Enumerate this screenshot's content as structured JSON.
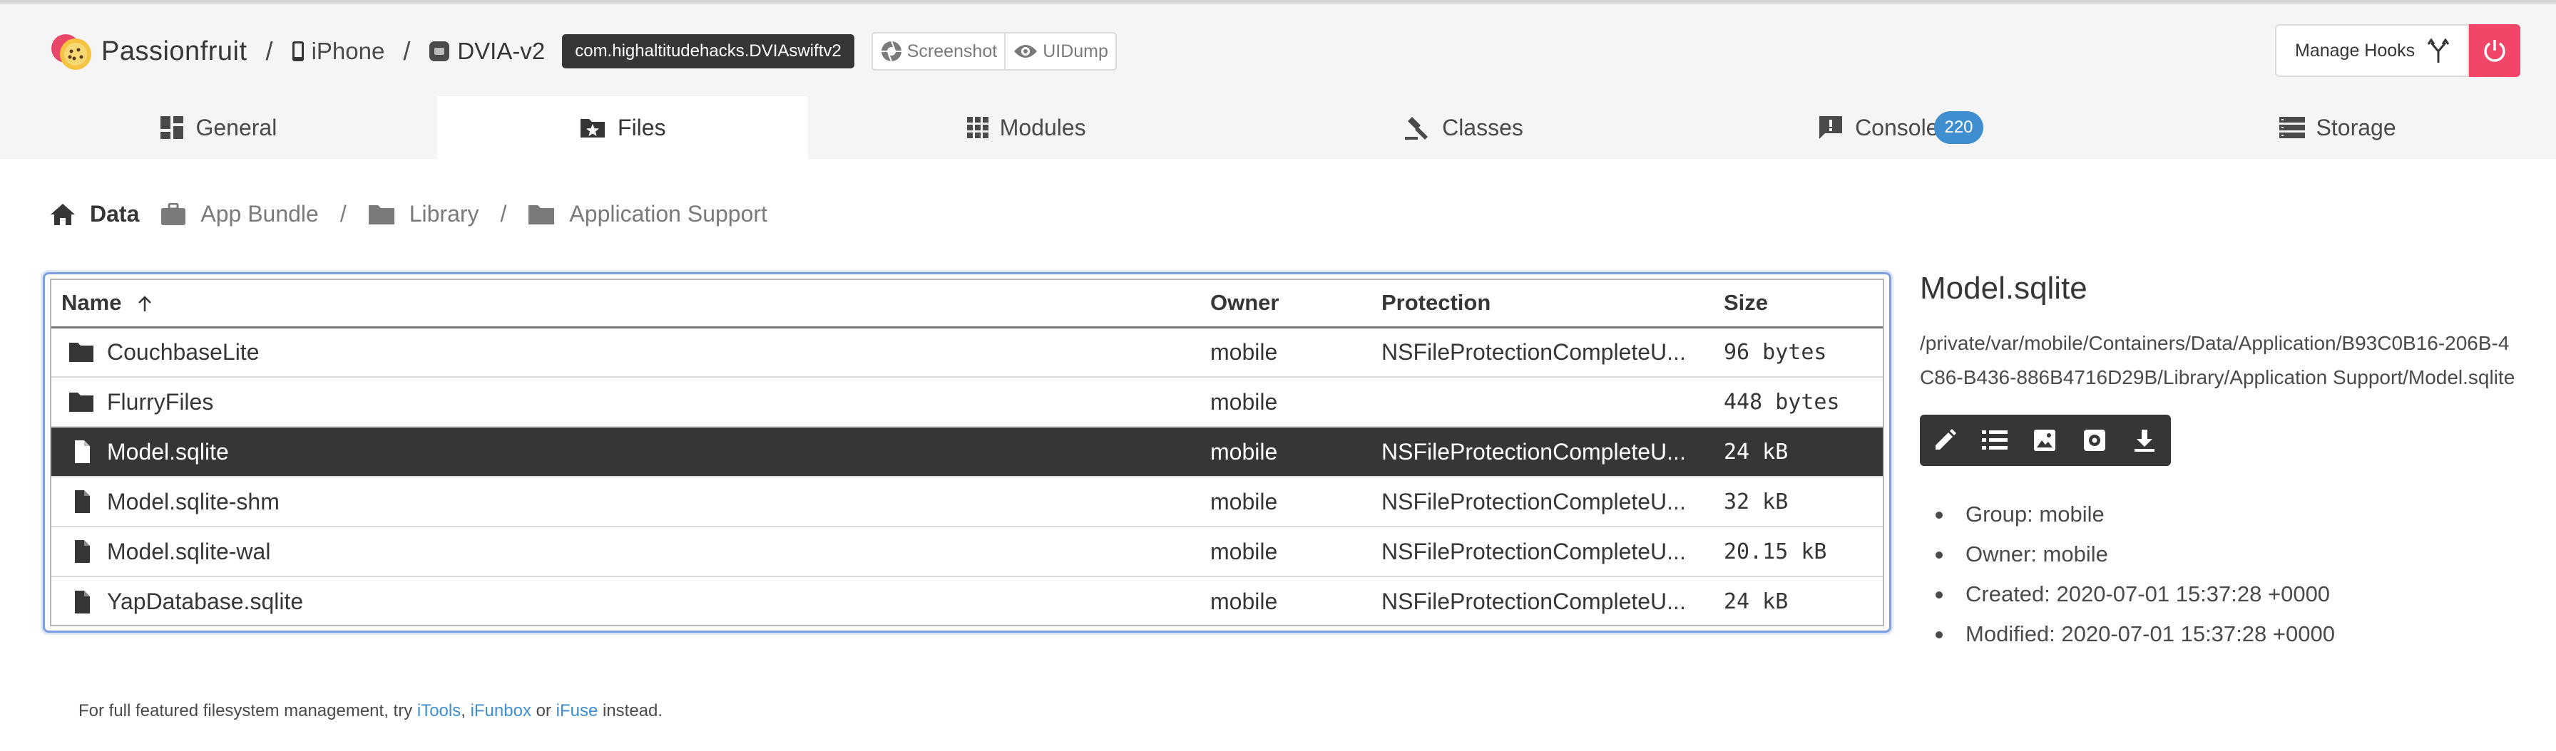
{
  "app": {
    "name": "Passionfruit"
  },
  "top_breadcrumb": {
    "device": "iPhone",
    "app": "DVIA-v2",
    "bundle_id": "com.highaltitudehacks.DVIAswiftv2"
  },
  "toolbar": {
    "screenshot_label": "Screenshot",
    "uidump_label": "UIDump",
    "manage_hooks_label": "Manage Hooks"
  },
  "tabs": [
    {
      "label": "General",
      "icon": "dashboard-icon"
    },
    {
      "label": "Files",
      "icon": "folder-star-icon",
      "active": true
    },
    {
      "label": "Modules",
      "icon": "grid-icon"
    },
    {
      "label": "Classes",
      "icon": "gavel-icon"
    },
    {
      "label": "Console",
      "icon": "alert-box-icon",
      "badge": "220"
    },
    {
      "label": "Storage",
      "icon": "storage-list-icon"
    }
  ],
  "breadcrumb": [
    "Data",
    "App Bundle",
    "Library",
    "Application Support"
  ],
  "table": {
    "headers": {
      "name": "Name",
      "owner": "Owner",
      "protection": "Protection",
      "size": "Size"
    },
    "sort": "ascending",
    "rows": [
      {
        "type": "folder",
        "name": "CouchbaseLite",
        "owner": "mobile",
        "protection": "NSFileProtectionCompleteU...",
        "size": "96 bytes"
      },
      {
        "type": "folder",
        "name": "FlurryFiles",
        "owner": "mobile",
        "protection": "",
        "size": "448 bytes"
      },
      {
        "type": "file",
        "name": "Model.sqlite",
        "owner": "mobile",
        "protection": "NSFileProtectionCompleteU...",
        "size": "24 kB",
        "selected": true
      },
      {
        "type": "file",
        "name": "Model.sqlite-shm",
        "owner": "mobile",
        "protection": "NSFileProtectionCompleteU...",
        "size": "32 kB"
      },
      {
        "type": "file",
        "name": "Model.sqlite-wal",
        "owner": "mobile",
        "protection": "NSFileProtectionCompleteU...",
        "size": "20.15 kB"
      },
      {
        "type": "file",
        "name": "YapDatabase.sqlite",
        "owner": "mobile",
        "protection": "NSFileProtectionCompleteU...",
        "size": "24 kB"
      }
    ]
  },
  "detail": {
    "title": "Model.sqlite",
    "path": "/private/var/mobile/Containers/Data/Application/B93C0B16-206B-4C86-B436-886B4716D29B/Library/Application Support/Model.sqlite",
    "actions": [
      "edit-icon",
      "list-icon",
      "image-icon",
      "settings-icon",
      "download-icon"
    ],
    "props": {
      "group": "Group: mobile",
      "owner": "Owner: mobile",
      "created": "Created: 2020-07-01 15:37:28 +0000",
      "modified": "Modified: 2020-07-01 15:37:28 +0000"
    }
  },
  "footnote": {
    "prefix": "For full featured filesystem management, try ",
    "link1": "iTools",
    "comma": ", ",
    "link2": "iFunbox",
    "or": " or ",
    "link3": "iFuse",
    "suffix": " instead."
  },
  "colors": {
    "accent_blue": "#3e8ed0",
    "danger": "#f14668",
    "dark": "#363636",
    "focus_border": "#7c9fe3"
  }
}
